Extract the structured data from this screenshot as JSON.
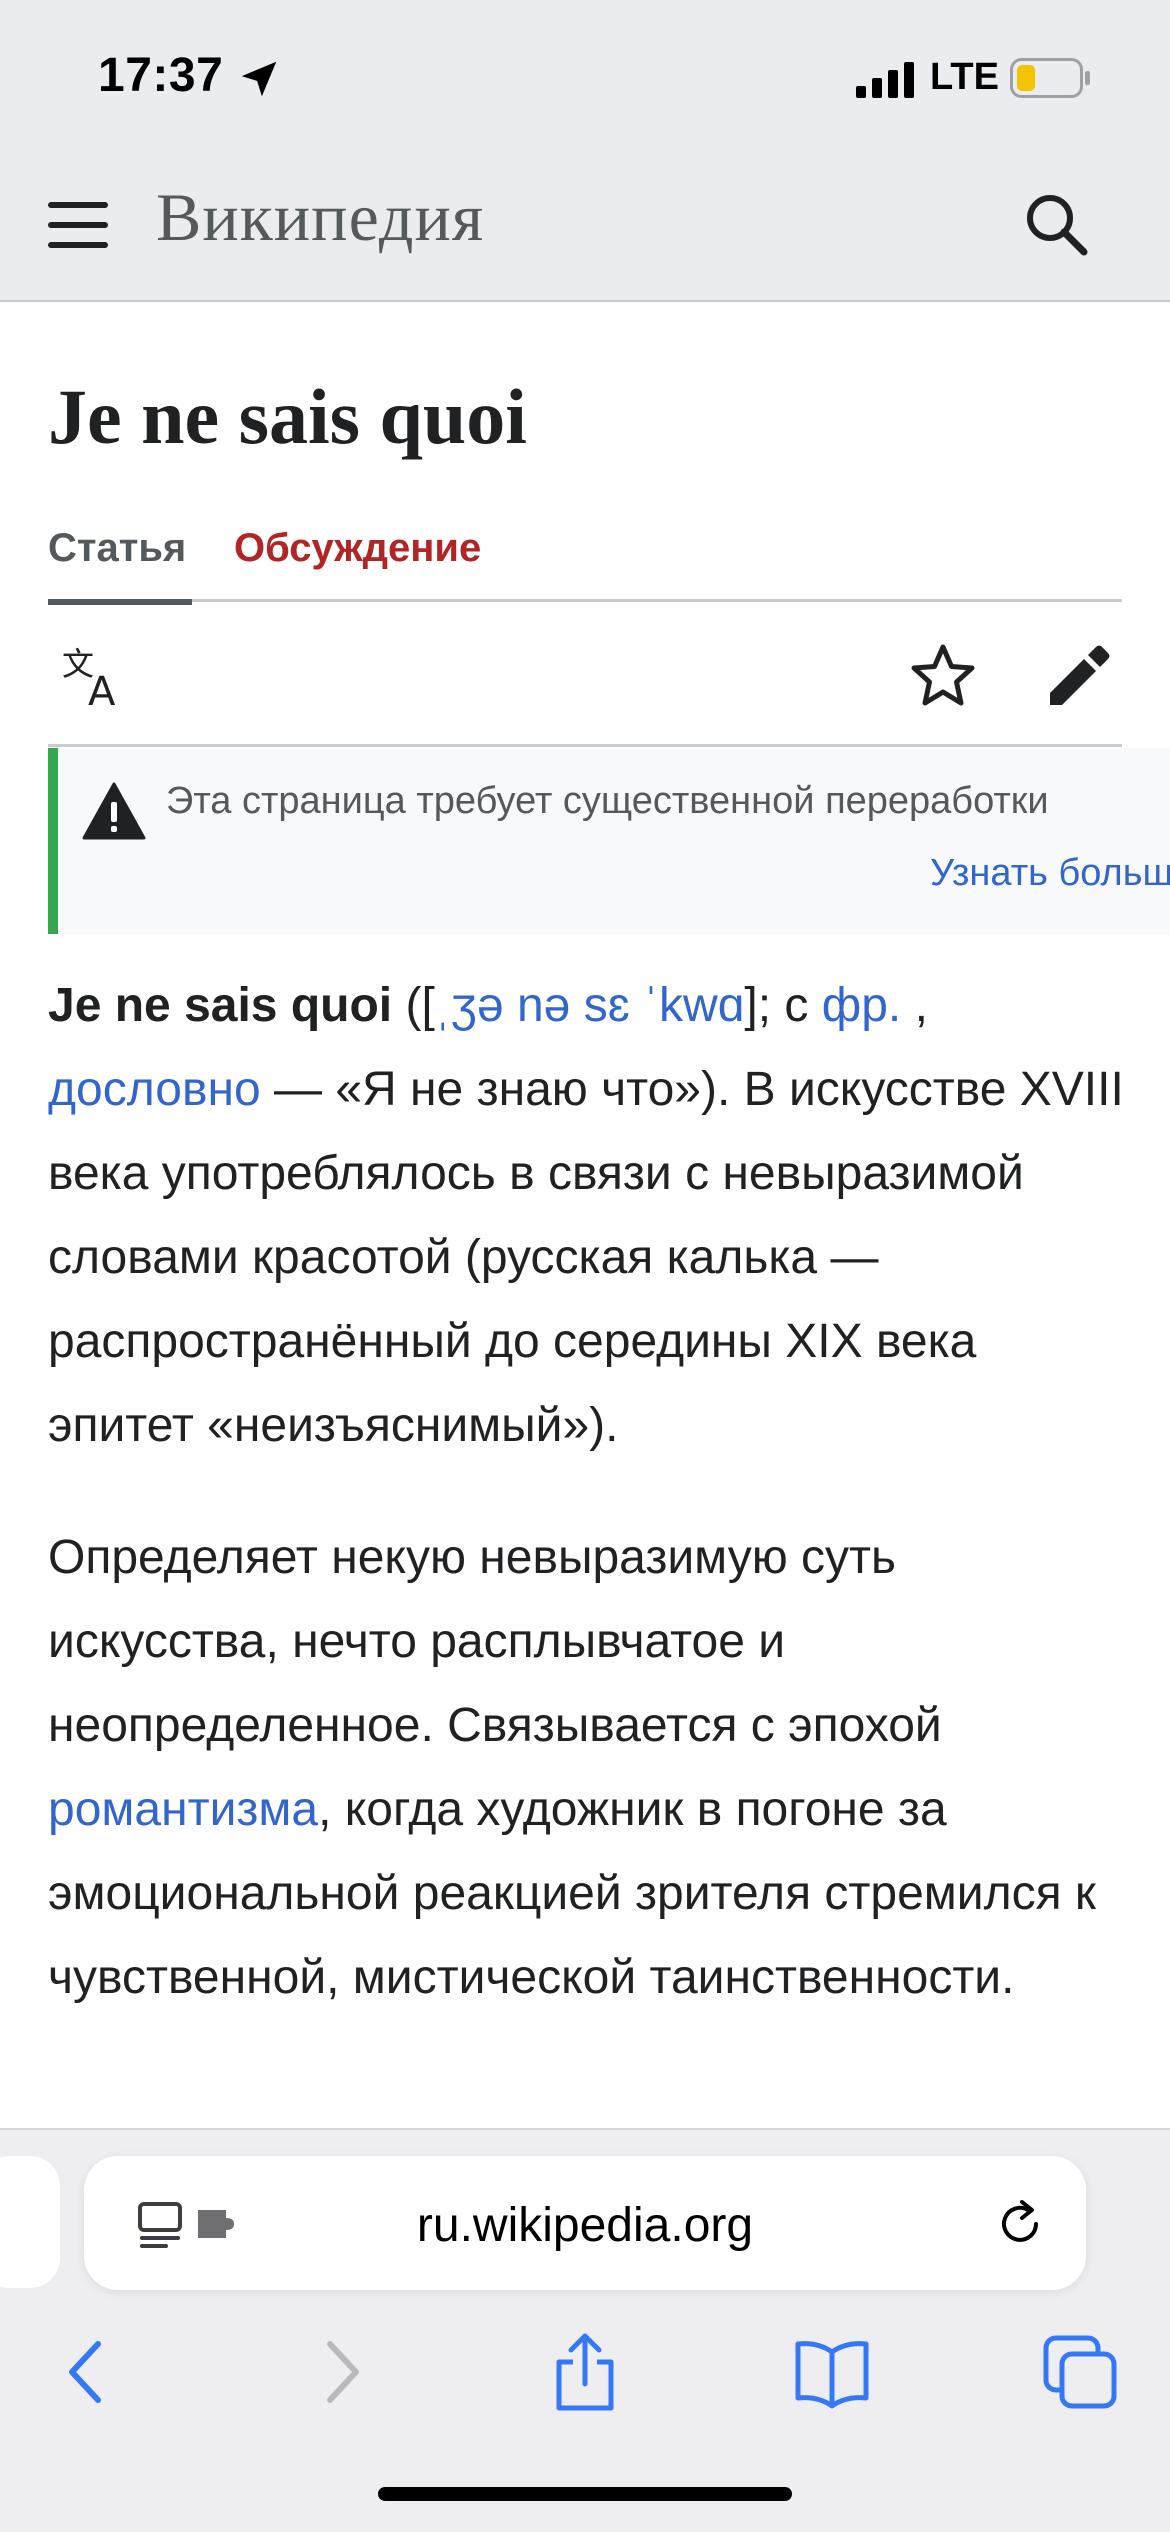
{
  "status_bar": {
    "time": "17:37",
    "network": "LTE",
    "icons": [
      "location-arrow-icon",
      "signal-bars-icon",
      "battery-low-icon"
    ]
  },
  "header": {
    "wordmark": "Википедия",
    "icons": [
      "menu-icon",
      "search-icon"
    ]
  },
  "article": {
    "title": "Je ne sais quoi",
    "tabs": [
      {
        "label": "Статья",
        "active": true
      },
      {
        "label": "Обсуждение",
        "active": false
      }
    ],
    "actions": [
      "language-icon",
      "star-icon",
      "edit-pencil-icon"
    ],
    "notice": {
      "text": "Эта страница требует существенной переработки",
      "link": "Узнать больше"
    },
    "p1": {
      "term": "Je ne sais quoi",
      "open": " ([",
      "ipa": "ˌʒə nə sɛ ˈkwɑ",
      "mid": "]; с ",
      "lang_link": "фр.",
      "comma": " ,",
      "lit_link": "дословно",
      "rest": " — «Я не знаю что»). В искусстве XVIII века употреблялось в связи с невыразимой словами красотой (русская калька — распространённый до середины XIX века эпитет «неизъяснимый»)."
    },
    "p2": {
      "before": "Определяет некую невыразимую суть искусства, нечто расплывчатое и неопределенное. Связывается с эпохой ",
      "link": "романтизма",
      "after": ", когда художник в погоне за эмоциональной реакцией зрителя стремился к чувственной, мистической таинственности."
    }
  },
  "browser": {
    "url": "ru.wikipedia.org",
    "toolbar_icons": [
      "back-icon",
      "forward-icon",
      "share-icon",
      "bookmarks-icon",
      "tabs-icon"
    ],
    "colors": {
      "accent": "#3478f6",
      "link": "#3366cc",
      "talk": "#b32424",
      "notice_bar": "#36a64f"
    }
  }
}
